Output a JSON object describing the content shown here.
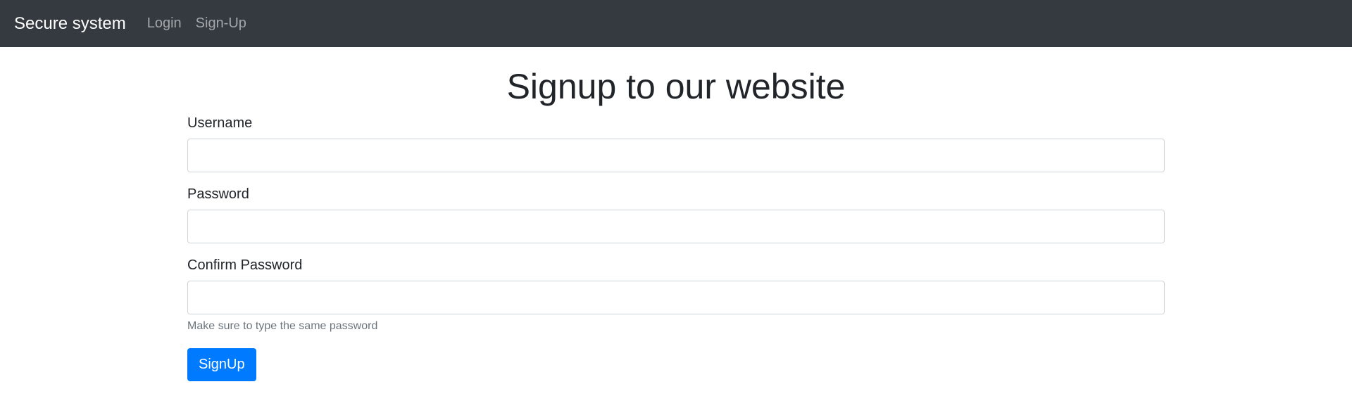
{
  "navbar": {
    "brand": "Secure system",
    "links": [
      "Login",
      "Sign-Up"
    ]
  },
  "main": {
    "title": "Signup to our website",
    "fields": {
      "username": {
        "label": "Username",
        "value": "",
        "placeholder": ""
      },
      "password": {
        "label": "Password",
        "value": "",
        "placeholder": ""
      },
      "confirm_password": {
        "label": "Confirm Password",
        "value": "",
        "placeholder": "",
        "help": "Make sure to type the same password"
      }
    },
    "submit_label": "SignUp"
  },
  "colors": {
    "navbar_bg": "#343a40",
    "primary": "#007bff",
    "muted": "#6c757d"
  }
}
